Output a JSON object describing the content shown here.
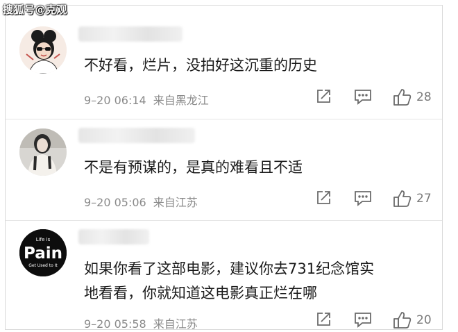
{
  "watermark": "搜狐号@克观",
  "comments": [
    {
      "text": "不好看，烂片，没拍好这沉重的历史",
      "time": "9–20 06:14",
      "location": "来自黑龙江",
      "likes": "28",
      "avatar_icon": "cartoon-girl-sunglasses-avatar"
    },
    {
      "text": "不是有预谋的，是真的难看且不适",
      "time": "9–20 05:06",
      "location": "来自江苏",
      "likes": "27",
      "avatar_icon": "woman-photo-avatar"
    },
    {
      "text": "如果你看了这部电影，建议你去731纪念馆实\n地看看，你就知道这电影真正烂在哪",
      "time": "9–20 05:58",
      "location": "来自江苏",
      "likes": "20",
      "avatar_icon": "life-is-pain-avatar",
      "avatar_text_top": "Life is",
      "avatar_text_main": "Pain",
      "avatar_text_bottom": "Get Used to It"
    }
  ],
  "colors": {
    "text": "#1a1a1a",
    "meta": "#8a8a8a",
    "icon": "#6b6b6b",
    "divider": "#e5e5e5"
  }
}
